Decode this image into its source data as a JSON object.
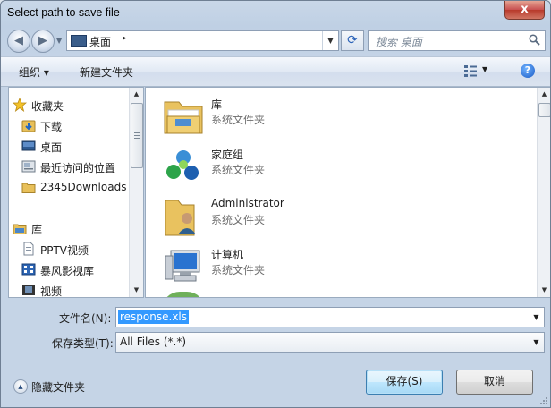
{
  "window": {
    "title": "Select path to save file",
    "close": "x"
  },
  "nav": {
    "back": "◀",
    "forward": "▶",
    "address": {
      "location": "桌面",
      "separator": "▸"
    },
    "refresh": "⟳",
    "search_placeholder": "搜索 桌面"
  },
  "toolbar": {
    "organize": "组织 ▾",
    "new_folder": "新建文件夹",
    "help": "?"
  },
  "sidebar": {
    "favorites": {
      "label": "收藏夹",
      "items": [
        {
          "label": "下载",
          "icon": "download-folder-icon"
        },
        {
          "label": "桌面",
          "icon": "desktop-icon"
        },
        {
          "label": "最近访问的位置",
          "icon": "recent-places-icon"
        },
        {
          "label": "2345Downloads",
          "icon": "folder-icon"
        }
      ]
    },
    "libraries": {
      "label": "库",
      "items": [
        {
          "label": "PPTV视频",
          "icon": "document-icon"
        },
        {
          "label": "暴风影视库",
          "icon": "video-library-icon"
        },
        {
          "label": "视频",
          "icon": "film-icon"
        }
      ]
    }
  },
  "files": [
    {
      "name": "库",
      "type": "系统文件夹",
      "icon": "libraries-icon"
    },
    {
      "name": "家庭组",
      "type": "系统文件夹",
      "icon": "homegroup-icon"
    },
    {
      "name": "Administrator",
      "type": "系统文件夹",
      "icon": "user-folder-icon"
    },
    {
      "name": "计算机",
      "type": "系统文件夹",
      "icon": "computer-icon"
    }
  ],
  "form": {
    "filename_label": "文件名(N):",
    "filename_value": "response.xls",
    "filetype_label": "保存类型(T):",
    "filetype_value": "All Files (*.*)"
  },
  "footer": {
    "hide_folders": "隐藏文件夹",
    "save": "保存(S)",
    "cancel": "取消"
  },
  "colors": {
    "selection": "#3399ff",
    "title_close": "#c75050"
  }
}
